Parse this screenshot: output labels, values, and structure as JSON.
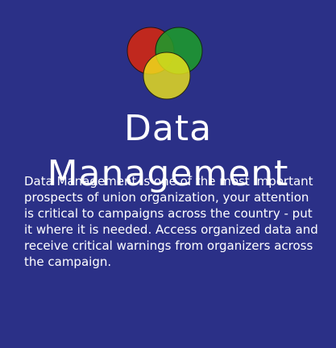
{
  "page": {
    "background_color": "#2b3087",
    "title": "Data Management",
    "description": "Data Management is one of the most important prospects of union organization, your attention is critical to campaigns across the country - put it where it is needed. Access organized data and receive critical warnings from organizers across the campaign."
  },
  "logo": {
    "icon": "venn-diagram-icon",
    "colors": {
      "red": "#c0281e",
      "green": "#1c9a2c",
      "yellow": "#f0e61a"
    }
  }
}
